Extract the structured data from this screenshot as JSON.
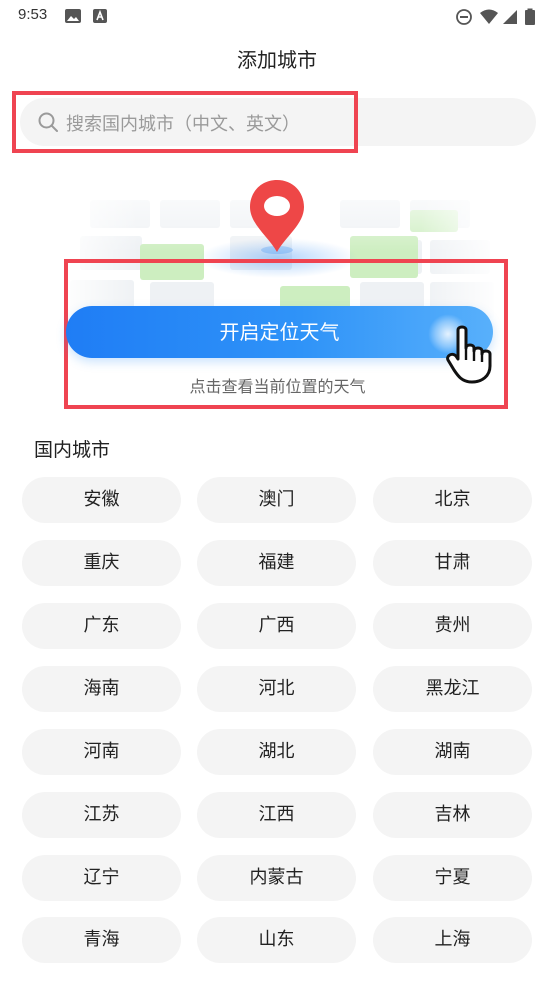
{
  "status_bar": {
    "time": "9:53",
    "icons": [
      "image-icon",
      "a-badge-icon",
      "dnd-icon",
      "wifi-icon",
      "signal-icon",
      "battery-icon"
    ]
  },
  "header": {
    "title": "添加城市"
  },
  "search": {
    "placeholder": "搜索国内城市（中文、英文）"
  },
  "location": {
    "button_label": "开启定位天气",
    "hint": "点击查看当前位置的天气"
  },
  "cities_section": {
    "title": "国内城市",
    "cities": [
      "安徽",
      "澳门",
      "北京",
      "重庆",
      "福建",
      "甘肃",
      "广东",
      "广西",
      "贵州",
      "海南",
      "河北",
      "黑龙江",
      "河南",
      "湖北",
      "湖南",
      "江苏",
      "江西",
      "吉林",
      "辽宁",
      "内蒙古",
      "宁夏",
      "青海",
      "山东",
      "上海"
    ]
  },
  "colors": {
    "accent": "#2f93f8",
    "highlight": "#ef4451",
    "chip_bg": "#f4f4f4",
    "pin": "#ee4747"
  }
}
